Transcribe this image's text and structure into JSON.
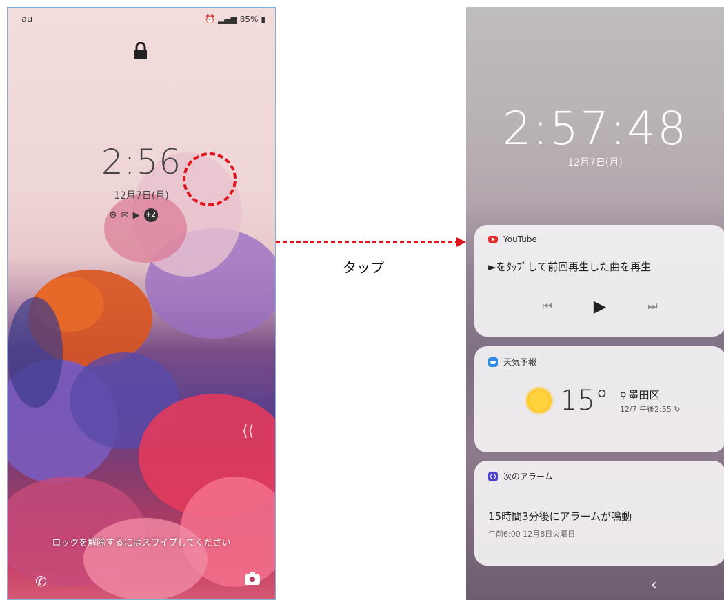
{
  "left_phone": {
    "carrier": "au",
    "status": {
      "battery": "85%"
    },
    "clock": "2:56",
    "date": "12月7日(月)",
    "notif_badge": "+2",
    "unlock_hint": "ロックを解除するにはスワイプしてください"
  },
  "annotation": {
    "tap_label": "タップ",
    "arrow_color": "#e3131b"
  },
  "right_phone": {
    "clock": "2:57:48",
    "date": "12月7日(月)",
    "youtube_card": {
      "app_name": "YouTube",
      "message": "►をﾀｯﾌﾟして前回再生した曲を再生"
    },
    "weather_card": {
      "app_name": "天気予報",
      "temperature": "15°",
      "location": "墨田区",
      "updated": "12/7 午後2:55"
    },
    "alarm_card": {
      "app_name": "次のアラーム",
      "title": "15時間3分後にアラームが鳴動",
      "subtitle": "午前6:00 12月8日火曜日"
    }
  }
}
